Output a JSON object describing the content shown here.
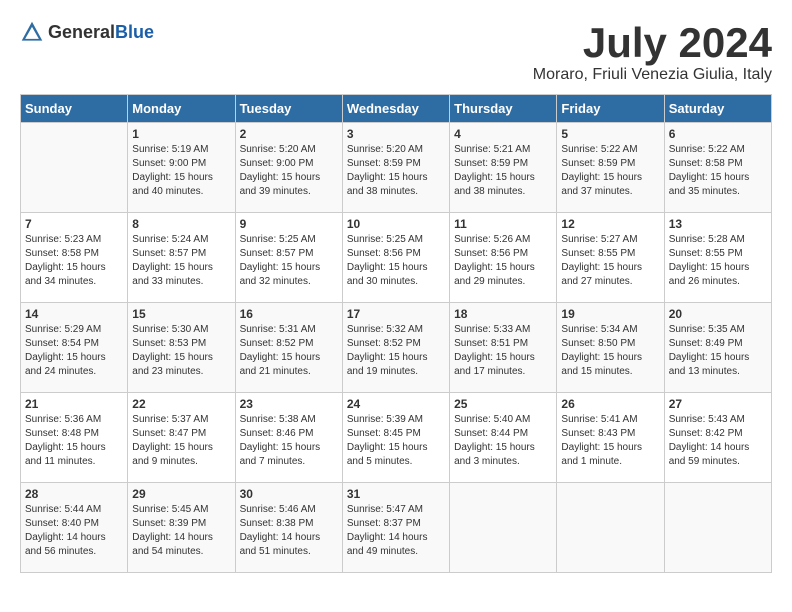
{
  "header": {
    "logo_general": "General",
    "logo_blue": "Blue",
    "month_year": "July 2024",
    "location": "Moraro, Friuli Venezia Giulia, Italy"
  },
  "days_of_week": [
    "Sunday",
    "Monday",
    "Tuesday",
    "Wednesday",
    "Thursday",
    "Friday",
    "Saturday"
  ],
  "weeks": [
    [
      {
        "day": "",
        "info": ""
      },
      {
        "day": "1",
        "info": "Sunrise: 5:19 AM\nSunset: 9:00 PM\nDaylight: 15 hours\nand 40 minutes."
      },
      {
        "day": "2",
        "info": "Sunrise: 5:20 AM\nSunset: 9:00 PM\nDaylight: 15 hours\nand 39 minutes."
      },
      {
        "day": "3",
        "info": "Sunrise: 5:20 AM\nSunset: 8:59 PM\nDaylight: 15 hours\nand 38 minutes."
      },
      {
        "day": "4",
        "info": "Sunrise: 5:21 AM\nSunset: 8:59 PM\nDaylight: 15 hours\nand 38 minutes."
      },
      {
        "day": "5",
        "info": "Sunrise: 5:22 AM\nSunset: 8:59 PM\nDaylight: 15 hours\nand 37 minutes."
      },
      {
        "day": "6",
        "info": "Sunrise: 5:22 AM\nSunset: 8:58 PM\nDaylight: 15 hours\nand 35 minutes."
      }
    ],
    [
      {
        "day": "7",
        "info": "Sunrise: 5:23 AM\nSunset: 8:58 PM\nDaylight: 15 hours\nand 34 minutes."
      },
      {
        "day": "8",
        "info": "Sunrise: 5:24 AM\nSunset: 8:57 PM\nDaylight: 15 hours\nand 33 minutes."
      },
      {
        "day": "9",
        "info": "Sunrise: 5:25 AM\nSunset: 8:57 PM\nDaylight: 15 hours\nand 32 minutes."
      },
      {
        "day": "10",
        "info": "Sunrise: 5:25 AM\nSunset: 8:56 PM\nDaylight: 15 hours\nand 30 minutes."
      },
      {
        "day": "11",
        "info": "Sunrise: 5:26 AM\nSunset: 8:56 PM\nDaylight: 15 hours\nand 29 minutes."
      },
      {
        "day": "12",
        "info": "Sunrise: 5:27 AM\nSunset: 8:55 PM\nDaylight: 15 hours\nand 27 minutes."
      },
      {
        "day": "13",
        "info": "Sunrise: 5:28 AM\nSunset: 8:55 PM\nDaylight: 15 hours\nand 26 minutes."
      }
    ],
    [
      {
        "day": "14",
        "info": "Sunrise: 5:29 AM\nSunset: 8:54 PM\nDaylight: 15 hours\nand 24 minutes."
      },
      {
        "day": "15",
        "info": "Sunrise: 5:30 AM\nSunset: 8:53 PM\nDaylight: 15 hours\nand 23 minutes."
      },
      {
        "day": "16",
        "info": "Sunrise: 5:31 AM\nSunset: 8:52 PM\nDaylight: 15 hours\nand 21 minutes."
      },
      {
        "day": "17",
        "info": "Sunrise: 5:32 AM\nSunset: 8:52 PM\nDaylight: 15 hours\nand 19 minutes."
      },
      {
        "day": "18",
        "info": "Sunrise: 5:33 AM\nSunset: 8:51 PM\nDaylight: 15 hours\nand 17 minutes."
      },
      {
        "day": "19",
        "info": "Sunrise: 5:34 AM\nSunset: 8:50 PM\nDaylight: 15 hours\nand 15 minutes."
      },
      {
        "day": "20",
        "info": "Sunrise: 5:35 AM\nSunset: 8:49 PM\nDaylight: 15 hours\nand 13 minutes."
      }
    ],
    [
      {
        "day": "21",
        "info": "Sunrise: 5:36 AM\nSunset: 8:48 PM\nDaylight: 15 hours\nand 11 minutes."
      },
      {
        "day": "22",
        "info": "Sunrise: 5:37 AM\nSunset: 8:47 PM\nDaylight: 15 hours\nand 9 minutes."
      },
      {
        "day": "23",
        "info": "Sunrise: 5:38 AM\nSunset: 8:46 PM\nDaylight: 15 hours\nand 7 minutes."
      },
      {
        "day": "24",
        "info": "Sunrise: 5:39 AM\nSunset: 8:45 PM\nDaylight: 15 hours\nand 5 minutes."
      },
      {
        "day": "25",
        "info": "Sunrise: 5:40 AM\nSunset: 8:44 PM\nDaylight: 15 hours\nand 3 minutes."
      },
      {
        "day": "26",
        "info": "Sunrise: 5:41 AM\nSunset: 8:43 PM\nDaylight: 15 hours\nand 1 minute."
      },
      {
        "day": "27",
        "info": "Sunrise: 5:43 AM\nSunset: 8:42 PM\nDaylight: 14 hours\nand 59 minutes."
      }
    ],
    [
      {
        "day": "28",
        "info": "Sunrise: 5:44 AM\nSunset: 8:40 PM\nDaylight: 14 hours\nand 56 minutes."
      },
      {
        "day": "29",
        "info": "Sunrise: 5:45 AM\nSunset: 8:39 PM\nDaylight: 14 hours\nand 54 minutes."
      },
      {
        "day": "30",
        "info": "Sunrise: 5:46 AM\nSunset: 8:38 PM\nDaylight: 14 hours\nand 51 minutes."
      },
      {
        "day": "31",
        "info": "Sunrise: 5:47 AM\nSunset: 8:37 PM\nDaylight: 14 hours\nand 49 minutes."
      },
      {
        "day": "",
        "info": ""
      },
      {
        "day": "",
        "info": ""
      },
      {
        "day": "",
        "info": ""
      }
    ]
  ]
}
